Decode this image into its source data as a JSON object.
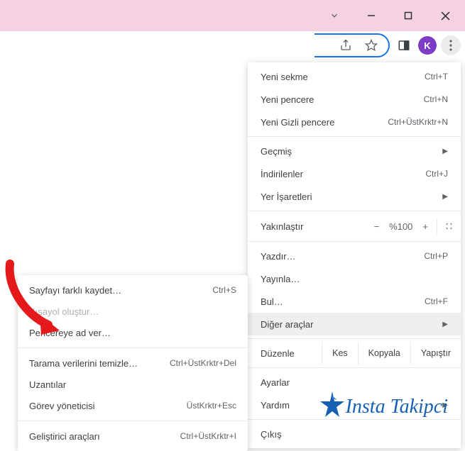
{
  "window": {
    "chevron_caption": "▾"
  },
  "toolbar": {
    "avatar_letter": "K"
  },
  "menu": {
    "new_tab": {
      "label": "Yeni sekme",
      "shortcut": "Ctrl+T"
    },
    "new_window": {
      "label": "Yeni pencere",
      "shortcut": "Ctrl+N"
    },
    "incognito": {
      "label": "Yeni Gizli pencere",
      "shortcut": "Ctrl+ÜstKrktr+N"
    },
    "history": {
      "label": "Geçmiş"
    },
    "downloads": {
      "label": "İndirilenler",
      "shortcut": "Ctrl+J"
    },
    "bookmarks": {
      "label": "Yer İşaretleri"
    },
    "zoom": {
      "label": "Yakınlaştır",
      "minus": "−",
      "value": "%100",
      "plus": "+"
    },
    "print": {
      "label": "Yazdır…",
      "shortcut": "Ctrl+P"
    },
    "cast": {
      "label": "Yayınla…"
    },
    "find": {
      "label": "Bul…",
      "shortcut": "Ctrl+F"
    },
    "more_tools": {
      "label": "Diğer araçlar"
    },
    "edit": {
      "label": "Düzenle",
      "cut": "Kes",
      "copy": "Kopyala",
      "paste": "Yapıştır"
    },
    "settings": {
      "label": "Ayarlar"
    },
    "help": {
      "label": "Yardım"
    },
    "exit": {
      "label": "Çıkış"
    }
  },
  "submenu": {
    "save_as": {
      "label": "Sayfayı farklı kaydet…",
      "shortcut": "Ctrl+S"
    },
    "shortcut": {
      "label": "Kısayol oluştur…"
    },
    "name_window": {
      "label": "Pencereye ad ver…"
    },
    "clear_browsing": {
      "label": "Tarama verilerini temizle…",
      "shortcut": "Ctrl+ÜstKrktr+Del"
    },
    "extensions": {
      "label": "Uzantılar"
    },
    "task_manager": {
      "label": "Görev yöneticisi",
      "shortcut": "ÜstKrktr+Esc"
    },
    "dev_tools": {
      "label": "Geliştirici araçları",
      "shortcut": "Ctrl+ÜstKrktr+I"
    }
  },
  "watermark": {
    "text": "Insta Takipci"
  }
}
